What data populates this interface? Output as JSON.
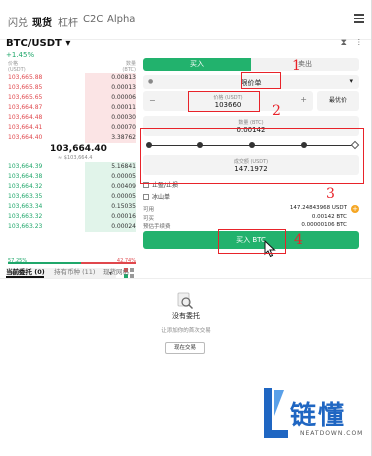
{
  "nav": {
    "tabs": [
      "闪兑",
      "现货",
      "杠杆",
      "C2C",
      "Alpha"
    ],
    "active": "现货"
  },
  "pair": {
    "symbol": "BTC/USDT",
    "change": "+1.45%",
    "header_icons": "⧗ ⫶"
  },
  "orderbook": {
    "price_header": "价格\n(USDT)",
    "qty_header": "数量\n(BTC)",
    "asks": [
      {
        "price": "103,665.88",
        "qty": "0.00813"
      },
      {
        "price": "103,665.85",
        "qty": "0.00013"
      },
      {
        "price": "103,665.65",
        "qty": "0.00006"
      },
      {
        "price": "103,664.87",
        "qty": "0.00011"
      },
      {
        "price": "103,664.48",
        "qty": "0.00030"
      },
      {
        "price": "103,664.41",
        "qty": "0.00070"
      },
      {
        "price": "103,664.40",
        "qty": "3.38762"
      }
    ],
    "mid_price": "103,664.40",
    "mid_usd": "≈ $103,664.4",
    "bids": [
      {
        "price": "103,664.39",
        "qty": "5.16841"
      },
      {
        "price": "103,664.38",
        "qty": "0.00005"
      },
      {
        "price": "103,664.32",
        "qty": "0.00409"
      },
      {
        "price": "103,663.35",
        "qty": "0.00005"
      },
      {
        "price": "103,663.34",
        "qty": "0.15035"
      },
      {
        "price": "103,663.32",
        "qty": "0.00016"
      },
      {
        "price": "103,663.23",
        "qty": "0.00024"
      }
    ],
    "buy_ratio": "57.25%",
    "sell_ratio": "42.74%",
    "depth_value": "0.01"
  },
  "trade": {
    "buy_tab": "买入",
    "sell_tab": "卖出",
    "order_type": "限价单",
    "price_label": "价格 (USDT)",
    "price_value": "103660",
    "bbo_label": "最优价",
    "amount_label": "数量 (BTC)",
    "amount_value": "0.00142",
    "total_label": "成交额 (USDT)",
    "total_value": "147.1972",
    "tp_sl": "止盈/止损",
    "iceberg": "冰山单",
    "available_label": "可用",
    "available_value": "147.24843968 USDT",
    "can_buy_label": "可买",
    "can_buy_value": "0.00142 BTC",
    "fee_label": "预估手续费",
    "fee_value": "0.00000106 BTC",
    "buy_button": "买入 BTC"
  },
  "annotations": {
    "n1": "1",
    "n2": "2",
    "n3": "3",
    "n4": "4"
  },
  "bottom": {
    "tab_orders": "当前委托 (0)",
    "tab_positions": "持有币种 (11)",
    "tab_grid": "现货网格",
    "empty_title": "没有委托",
    "empty_sub": "让添加你的首次交易",
    "go_trade": "现在交易"
  },
  "watermark": {
    "text": "链懂",
    "sub": "NEATDOWN.COM"
  }
}
